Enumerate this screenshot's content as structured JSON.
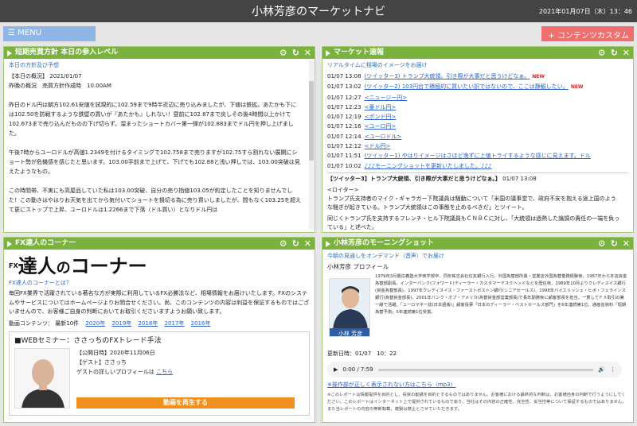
{
  "header": {
    "title": "小林芳彦のマーケットナビ",
    "datetime": "2021年01月07日（木）13：46"
  },
  "menu": {
    "menu_label": "MENU",
    "custom_label": "コンテンツカスタム"
  },
  "p1": {
    "title": "短期売買方針 本日の参入レベル",
    "subtitle": "本日の方針及び予想",
    "box_label": "【本日の概況】",
    "box_date": "2021/01/07",
    "lead": "昨晩の概況　売買方針作成時　10.00AM",
    "para1": "昨日のドル円は朝方102.61安値を試現的に102.59まで9時半近辺に売り込みましたが、下値は鉄拡。あたかも下には102.50を防戦するような鉄壁の買いが『あたかも』しれない！昼前に102.87まで戻しその後4時間以上かけて102.673まで売り込んだものの下げ切らず。溜まったショートカバー第一弾が102.883までドル円を押し上げました。",
    "para2": "午後7時からユーロドルが高値1.2349を付けるタイミングで102.758まで売りますが102.75すら割れない展開にショート勢が危機感を感じたと思います。103.00手前まで上げて、下げても102.88と浅い押しでは、103.00突破は見えたようなもの。",
    "para3": "この時間帯、不実にも高屋品していた私は103.00突破、自分の売り指値103.05が約定したことを知りませんでした！この動きはやはりお天気を出てから気付いてショートを損切る為に売り買いしましたが、間もなく103.25を超えて更にストップで上昇、ユーロドルは1.2266まで下落（ドル買い）となりドル円は"
  },
  "p2": {
    "title": "マーケット速報",
    "subtitle": "リアルタイムに相場のイメージをお届け",
    "news": [
      {
        "time": "01/07 13:08",
        "text": "(ツイッター3) トランプ大統領、引き際が大事だと思うけどなぁ。",
        "new": "NEW"
      },
      {
        "time": "01/07 13:02",
        "text": "(ツイッター2) 103円台で積極的に買いたい訳ではないので、ここは静観したい。",
        "new": "NEW"
      },
      {
        "time": "01/07 12:27",
        "text": "<ニュージー円>",
        "new": ""
      },
      {
        "time": "01/07 12:23",
        "text": "<豪ドル円>",
        "new": ""
      },
      {
        "time": "01/07 12:19",
        "text": "<ポンド円>",
        "new": ""
      },
      {
        "time": "01/07 12:16",
        "text": "<ユーロ円>",
        "new": ""
      },
      {
        "time": "01/07 12:14",
        "text": "<ユーロドル>",
        "new": ""
      },
      {
        "time": "01/07 12:12",
        "text": "<ドル円>",
        "new": ""
      },
      {
        "time": "01/07 11:51",
        "text": "(ツイッター1) やはりイメージはさほど逸ずに上値トライするような感じに見えます。ドル",
        "new": ""
      },
      {
        "time": "01/07 10:02",
        "text": "♪♪♪モーニングショットを更新いたしました。♪♪♪",
        "new": ""
      }
    ],
    "detail_title": "【ツイッター3】トランプ大統領、引き際が大事だと思うけどなぁ。】",
    "detail_time": "01/07 13:08",
    "detail_src": "<ロイター>",
    "detail_text1": "トランプ氏支持者のマイク・ギャラガー下院議員は騒動について「米国の議事堂で、政府不安を抱える途上国のような騒ぎが起きている。トランプ大統領はこの事態を止めるべきだ」とツイート。",
    "detail_text2": "同じくトランプ氏を支持するフレンチ・ヒル下院議員もＣＮＢＣに対し、「大統領は過熱した論調の責任の一端を負っている」と述べた。"
  },
  "p3": {
    "title": "FX達人のコーナー",
    "logo_fx": "FX",
    "logo_big": "達人",
    "logo_small": "の",
    "logo_rest": "コーナー",
    "about": "FX達人のコーナーとは？",
    "desc": "毎回FX業界で活躍されている著名な方が実際に利用しているFX必勝法など、相場情報をお届けいたします。FXのシステムやサービスについてはホームページよりお問合せください。尚、このコンテンツの内容は利益を保証するものではございませんので、お客様ご自身の判断においてお取引くださいますようお願い致します。",
    "content_label": "動画コンテンツ：",
    "latest": "最新10件",
    "years": [
      "2020年",
      "2019年",
      "2018年",
      "2017年",
      "2016年"
    ],
    "webinar_title": "■WEBセミナー：ささっちのFXトレード手法",
    "held_label": "【公開日時】2020年11月06日",
    "guest_label": "【ゲスト】ささっち",
    "profile_prefix": "ゲストの詳しいプロフィールは",
    "profile_link": "こちら",
    "play": "動画を再生する"
  },
  "p4": {
    "title": "小林芳彦のモーニングショット",
    "subtitle": "今朝の見通しをオンデマンド（音声）でお届け",
    "profile_title": "小林芳彦 プロフィール",
    "name_tag": "小林 芳彦",
    "bio": "1979年3月慶応義塾大学商学部卒、同年株式会社住友銀行入行。外国為替部所属・営業店外国為替業務経験後、1987年から本店資金為替部副長。インターバンク(フォワード)ディーラー・カスタマーデスクヘッドなどを歴任後、1989年10月よりクレディスイス銀行(資金為替部長)、1997年クレディスイス・ファーストボストン銀行(シニアセールス)、1998年バイエリッシェ・ヒポ・フェラインス銀行(為替資金部長)、2001年バンク・オブ・アメリカ(為替資金部営業部長)で長年勤務後に顧客部長を担当。一貫してＦＸ取引の第一線で活躍。「ユーロマネー誌(日本語版)」顧客投票「日本のディーラー・ベストセールス部門」を6年連続第1位、通産省資料「短期為替予測」5年連続第1位受賞。",
    "update_label": "更新日時：",
    "update_value": "01/07　10：22",
    "time": "0:00 / 7:59",
    "mp3_link": "※操作部が正しく表示されない方はこちら（mp3）",
    "disclaimer": "※このレポートは情報提供を目的とし、投資の勧誘を目的とするものではありません。お客様における最終的な判断は、お客様自身の判断で行うようにしてください。このレポートはインターネット上で提供されているものであり、当社はその内容の正確性、完全性、妥当性等について保証するものではありません。また当レポートの内容の無断転載、複製は禁止とさせていただきます。"
  }
}
